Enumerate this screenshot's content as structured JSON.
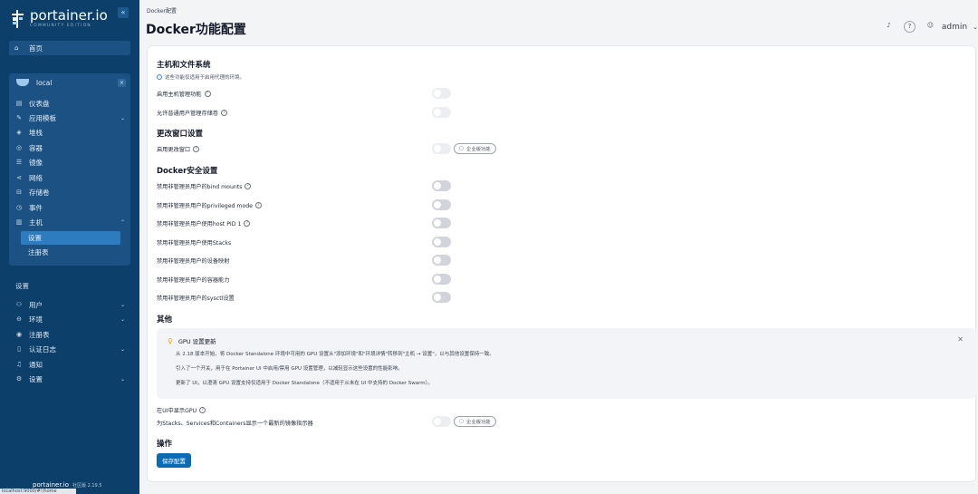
{
  "sidebar": {
    "brand": "portainer.io",
    "edition": "COMMUNITY EDITION",
    "home": "首页",
    "env_name": "local",
    "env_items": [
      "仪表盘",
      "应用模板",
      "堆栈",
      "容器",
      "镜像",
      "网络",
      "存储卷",
      "事件",
      "主机"
    ],
    "host_sub": [
      "设置",
      "注册表"
    ],
    "settings_title": "设置",
    "settings_items": [
      "用户",
      "环境",
      "注册表",
      "认证日志",
      "通知",
      "设置"
    ],
    "footer_brand": "portainer.io",
    "footer_edition": "社区版 2.19.5",
    "status_url": "localhost:9000/#!/home"
  },
  "header": {
    "breadcrumb": "Docker配置",
    "title": "Docker功能配置",
    "user": "admin"
  },
  "sections": {
    "host": {
      "title": "主机和文件系统",
      "note": "这些功能仅适用于启用代理的环境。",
      "enable_host_mgmt": "启用主机管理功能",
      "allow_volume_mgmt": "允许普通用户管理存储卷"
    },
    "window": {
      "title": "更改窗口设置",
      "enable_change_window": "启用更改窗口",
      "enterprise_badge": "企业版功能"
    },
    "security": {
      "title": "Docker安全设置",
      "items": [
        "禁用非管理员用户的bind mounts",
        "禁用非管理员用户的privileged mode",
        "禁用非管理员用户使用host PID 1",
        "禁用非管理员用户使用Stacks",
        "禁用非管理员用户的设备映射",
        "禁用非管理员用户的容器能力",
        "禁用非管理员用户的sysctl设置"
      ]
    },
    "other": {
      "title": "其他",
      "gpu_title": "GPU 设置更新",
      "gpu_lines": [
        "从 2.18 版本开始，将 Docker Standalone 环境中可用的 GPU 设置从\"添加环境\"和\"环境详情\"转移到\"主机 → 设置\"，以与其他设置保持一致。",
        "引入了一个开关，用于在 Portainer UI 中启用/禁用 GPU 设置管理，以减轻显示这些设置的性能影响。",
        "更新了 UI，以澄清 GPU 设置支持仅适用于 Docker Standalone（不适用于从未在 UI 中支持的 Docker Swarm）。"
      ],
      "show_gpu": "在UI中显示GPU",
      "show_image_indicator": "为Stacks、Services和Containers显示一个最新的镜像指示器",
      "enterprise_badge": "企业版功能"
    },
    "actions": {
      "title": "操作",
      "save": "保存配置"
    }
  }
}
